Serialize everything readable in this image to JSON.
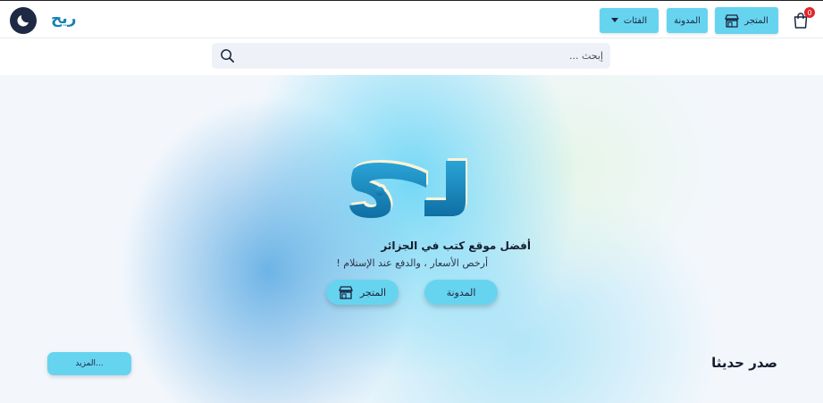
{
  "navbar": {
    "brand": "ريح",
    "theme_icon": "moon-icon",
    "categories_label": "الفئات",
    "blog_label": "المدونة",
    "store_label": "المتجر",
    "cart_count": "0",
    "cart_icon": "shopping-bag-icon"
  },
  "search": {
    "placeholder": "إبحث ...",
    "value": ""
  },
  "hero": {
    "logo_text": "ريح",
    "title": "أفضل موقع كتب في الجزائر",
    "subtitle": "أرخص الأسعار ، والدفع عند الإستلام !",
    "store_label": "المتجر",
    "blog_label": "المدونة"
  },
  "recent": {
    "title": "صدر حديثا",
    "more_label": "المزيد..."
  },
  "colors": {
    "accent": "#67d4ef",
    "brand": "#1380b3",
    "dark": "#1e2a44",
    "badge": "#e0262b"
  }
}
